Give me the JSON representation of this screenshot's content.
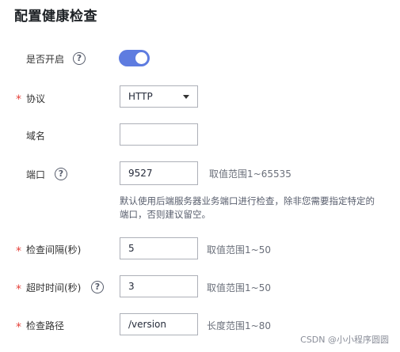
{
  "page": {
    "title": "配置健康检查"
  },
  "form": {
    "enabled": {
      "label": "是否开启",
      "help_icon": "question-circle-icon",
      "value": true,
      "accent": "#5e7ce0"
    },
    "protocol": {
      "label": "协议",
      "required": "*",
      "value": "HTTP",
      "arrow_icon": "caret-down-icon"
    },
    "domain": {
      "label": "域名",
      "value": "",
      "placeholder": ""
    },
    "port": {
      "label": "端口",
      "help_icon": "question-circle-icon",
      "value": "9527",
      "range_hint": "取值范围1~65535",
      "description_line1": "默认使用后端服务器业务端口进行检查，除非您需要指定特定的",
      "description_line2": "端口，否则建议留空。"
    },
    "interval": {
      "label": "检查间隔(秒)",
      "required": "*",
      "value": "5",
      "range_hint": "取值范围1~50"
    },
    "timeout": {
      "label": "超时时间(秒)",
      "required": "*",
      "help_icon": "question-circle-icon",
      "value": "3",
      "range_hint": "取值范围1~50"
    },
    "path": {
      "label": "检查路径",
      "required": "*",
      "value": "/version",
      "range_hint": "长度范围1~80"
    }
  },
  "watermark": "CSDN @小小程序圆圆",
  "colors": {
    "required_star": "#e5413a",
    "toggle_on": "#5e7ce0"
  }
}
